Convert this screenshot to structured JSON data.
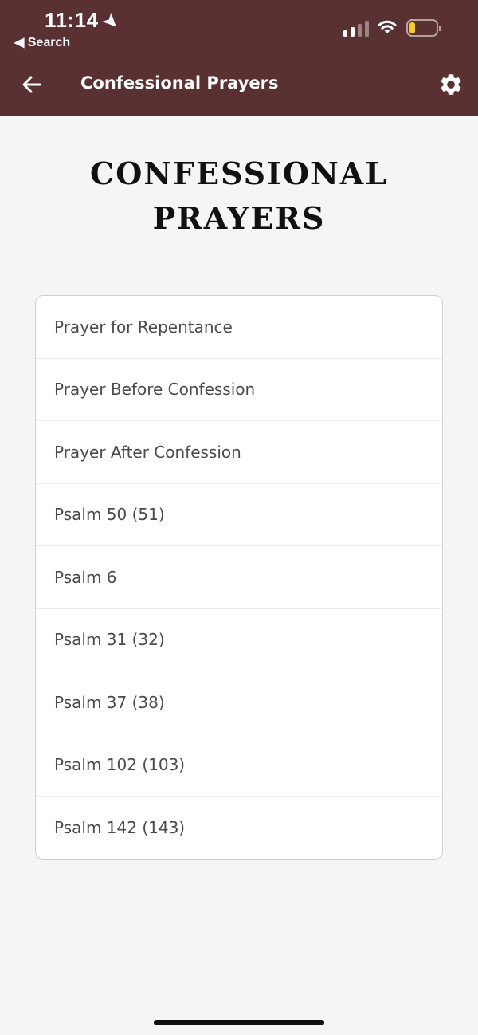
{
  "status_bar": {
    "time": "11:14",
    "back_app": "◀ Search"
  },
  "header": {
    "title": "Confessional Prayers",
    "background": "#5a3132"
  },
  "page": {
    "heading_line1": "Confessional",
    "heading_line2": "Prayers"
  },
  "list": {
    "items": [
      {
        "label": "Prayer for Repentance"
      },
      {
        "label": "Prayer Before Confession"
      },
      {
        "label": "Prayer After Confession"
      },
      {
        "label": "Psalm 50 (51)"
      },
      {
        "label": "Psalm 6"
      },
      {
        "label": "Psalm 31 (32)"
      },
      {
        "label": "Psalm 37 (38)"
      },
      {
        "label": "Psalm 102 (103)"
      },
      {
        "label": "Psalm 142 (143)"
      }
    ]
  },
  "icons": {
    "back": "arrow-left-icon",
    "settings": "gear-icon",
    "location": "location-arrow-icon",
    "signal": "cellular-signal-icon",
    "wifi": "wifi-icon",
    "battery": "battery-icon"
  },
  "battery_level": 0.2
}
